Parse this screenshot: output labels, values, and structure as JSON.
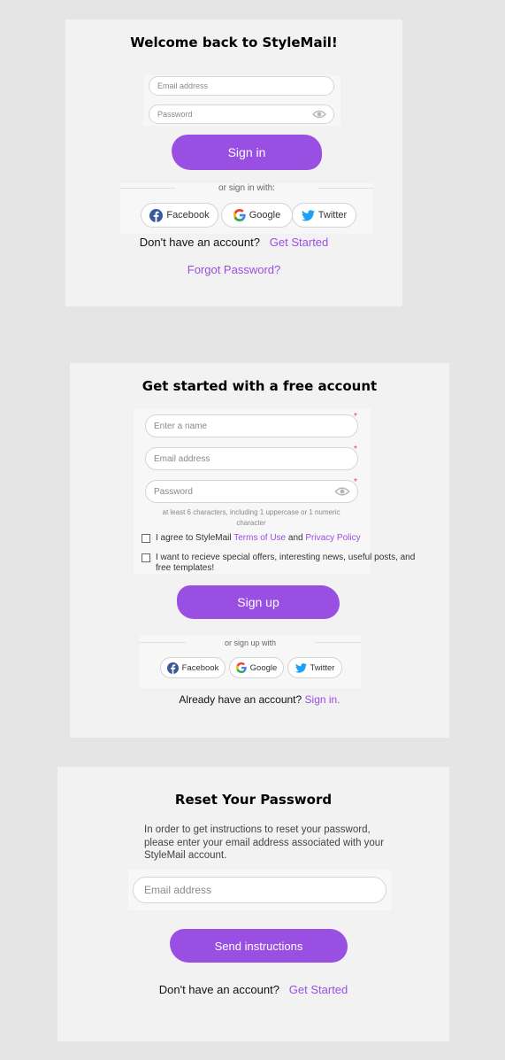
{
  "colors": {
    "accent": "#9a4fe3",
    "background": "#e5e5e5",
    "card": "#f2f2f2",
    "required": "#e0454a"
  },
  "signin": {
    "title": "Welcome back to StyleMail!",
    "email_placeholder": "Email address",
    "password_placeholder": "Password",
    "submit_label": "Sign in",
    "divider_text": "or sign in with:",
    "social": [
      "Facebook",
      "Google",
      "Twitter"
    ],
    "no_account_text": "Don't have an account?",
    "get_started_link": "Get Started",
    "forgot_link": "Forgot Password?"
  },
  "signup": {
    "title": "Get started with a free account",
    "name_placeholder": "Enter a name",
    "email_placeholder": "Email address",
    "password_placeholder": "Password",
    "password_hint": "at least 6 characters, including 1 uppercase or 1 numeric character",
    "terms_prefix": "I agree to StyleMail",
    "terms_link": "Terms of Use",
    "terms_and": "and",
    "privacy_link": "Privacy Policy",
    "offers_text": "I want to recieve special offers, interesting news, useful posts, and free templates!",
    "submit_label": "Sign up",
    "divider_text": "or sign up with",
    "social": [
      "Facebook",
      "Google",
      "Twitter"
    ],
    "have_account_text": "Already have an account?",
    "signin_link": "Sign in."
  },
  "reset": {
    "title": "Reset Your Password",
    "description": "In order to get instructions to reset your password, please enter your email address associated with your StyleMail account.",
    "email_placeholder": "Email address",
    "submit_label": "Send instructions",
    "no_account_text": "Don't have an account?",
    "get_started_link": "Get Started"
  },
  "icons": [
    "eye-icon",
    "facebook-icon",
    "google-icon",
    "twitter-icon"
  ]
}
